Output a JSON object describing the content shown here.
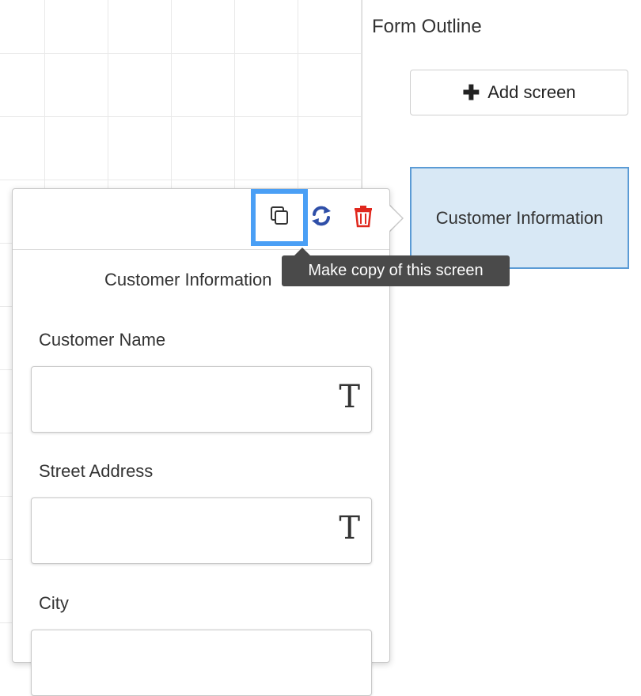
{
  "outline": {
    "title": "Form Outline",
    "add_screen_label": "Add screen",
    "screens": [
      {
        "label": "Customer Information"
      }
    ]
  },
  "popover": {
    "title": "Customer Information",
    "actions": [
      {
        "icon": "copy-icon"
      },
      {
        "icon": "refresh-icon",
        "color": "#2f4fa8"
      },
      {
        "icon": "trash-icon",
        "color": "#e0281e"
      }
    ],
    "tooltip": "Make copy of this screen",
    "fields": [
      {
        "label": "Customer Name",
        "type_icon": "T"
      },
      {
        "label": "Street Address",
        "type_icon": "T"
      },
      {
        "label": "City"
      }
    ]
  },
  "colors": {
    "accent_highlight": "#4a9ff5",
    "selected_screen_bg": "#d8e8f5",
    "selected_screen_border": "#5b9bd5"
  }
}
